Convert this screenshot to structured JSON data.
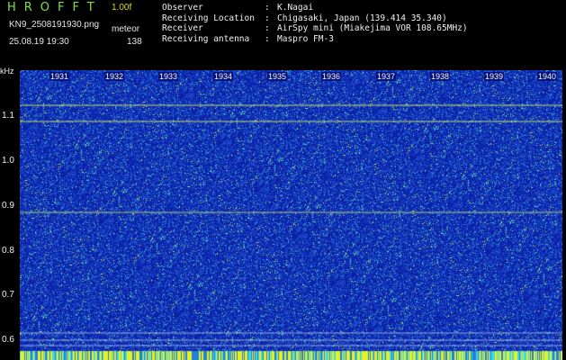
{
  "header": {
    "app_title": "HROFFT",
    "version": "1.00f",
    "filename": "KN9_2508191930.png",
    "mode": "meteor",
    "datetime": "25.08.19 19:30",
    "count": "138"
  },
  "meta": [
    {
      "key": "Observer",
      "value": "K.Nagai"
    },
    {
      "key": "Receiving Location",
      "value": "Chigasaki, Japan (139.414 35.340)"
    },
    {
      "key": "Receiver",
      "value": "AirSpy mini (Miakejima VOR 108.65MHz)"
    },
    {
      "key": "Receiving antenna",
      "value": "Maspro FM-3"
    }
  ],
  "spectrogram": {
    "y_unit": "kHz",
    "y_ticks": [
      "1.1",
      "1.0",
      "0.9",
      "0.8",
      "0.7",
      "0.6"
    ],
    "x_ticks": [
      "1931",
      "1932",
      "1933",
      "1934",
      "1935",
      "1936",
      "1937",
      "1938",
      "1939",
      "1940"
    ],
    "colors": {
      "background": "#0a1fa8",
      "noise_low": "#2a6ad8",
      "noise_mid": "#3fd0d0",
      "noise_high": "#d8f040",
      "line": "#d8f060"
    }
  }
}
